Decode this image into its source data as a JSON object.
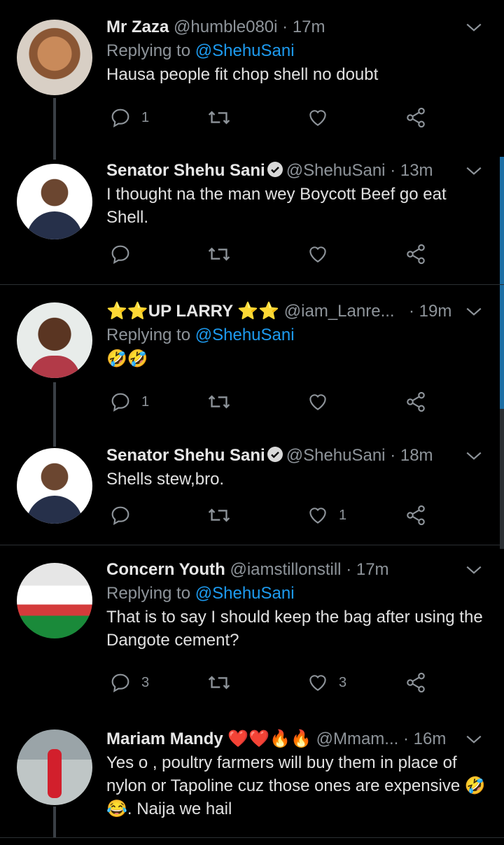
{
  "tweets": [
    {
      "name": "Mr Zaza",
      "handle": "@humble080i",
      "time": "· 17m",
      "replying_label": "Replying to",
      "replying_to": "@ShehuSani",
      "text": "Hausa people fit chop shell no doubt",
      "reply_count": "1",
      "retweet_count": "",
      "like_count": ""
    },
    {
      "name": "Senator Shehu Sani",
      "handle": "@ShehuSani",
      "time": "· 13m",
      "text": "I thought na the man wey Boycott Beef go eat Shell.",
      "reply_count": "",
      "retweet_count": "",
      "like_count": ""
    },
    {
      "name": "⭐⭐UP LARRY ⭐⭐",
      "handle": "@iam_Lanre...",
      "time": "· 19m",
      "replying_label": "Replying to",
      "replying_to": "@ShehuSani",
      "text": "🤣🤣",
      "reply_count": "1",
      "retweet_count": "",
      "like_count": ""
    },
    {
      "name": "Senator Shehu Sani",
      "handle": "@ShehuSani",
      "time": "· 18m",
      "text": "Shells stew,bro.",
      "reply_count": "",
      "retweet_count": "",
      "like_count": "1"
    },
    {
      "name": "Concern Youth",
      "handle": "@iamstillonstill",
      "time": "· 17m",
      "replying_label": "Replying to",
      "replying_to": "@ShehuSani",
      "text": "That is to say I should keep the bag after using the Dangote cement?",
      "reply_count": "3",
      "retweet_count": "",
      "like_count": "3"
    },
    {
      "name": "Mariam Mandy ❤️❤️🔥🔥",
      "handle": "@Mmam...",
      "time": "· 16m",
      "text": "Yes o , poultry farmers will buy them in place of nylon or Tapoline cuz those ones are expensive 🤣😂. Naija we hail"
    }
  ],
  "icons": {
    "reply": "reply-icon",
    "retweet": "retweet-icon",
    "like": "heart-icon",
    "share": "share-icon",
    "more": "chevron-down-icon",
    "verified": "verified-badge-icon"
  },
  "colors": {
    "background": "#000000",
    "accent": "#1d9bf0",
    "muted": "#8e949a"
  }
}
